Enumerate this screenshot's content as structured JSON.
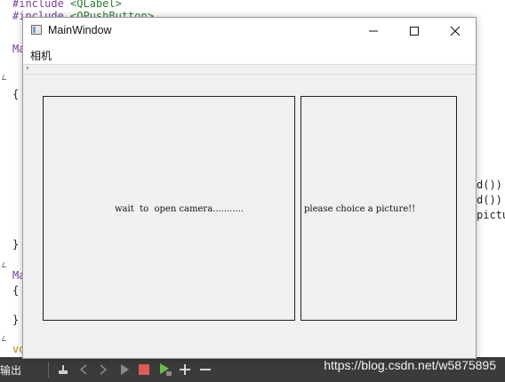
{
  "editor": {
    "line1_kw": "#include",
    "line1_str": "<QLabel>",
    "line2_kw": "#include",
    "line2_str": "<QPushButton>",
    "side_left": [
      "Ma",
      "{",
      "}",
      "Ma",
      "{",
      "}",
      "vo"
    ],
    "side_right": [
      "d())",
      "d())",
      "pictu"
    ]
  },
  "taskbar": {
    "output_label": "输出",
    "watermark": "https://blog.csdn.net/w5875895"
  },
  "window": {
    "title": "MainWindow",
    "menu_camera": "相机",
    "camera_placeholder": "wait  to  open camera...........",
    "picture_placeholder": "please choice a picture!!"
  },
  "colors": {
    "window_bg": "#f0f0f0",
    "taskbar_bg": "#3b3b3b",
    "stop_red": "#e05a5a",
    "run_green": "#6cbf4a"
  }
}
